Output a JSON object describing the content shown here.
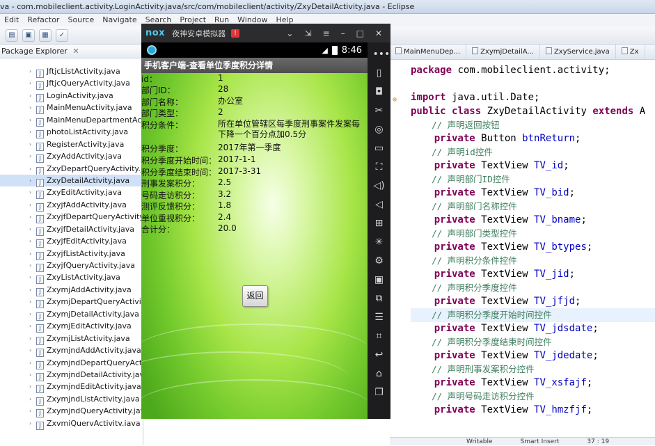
{
  "window": {
    "title": "va - com.mobileclient.activity.LoginActivity.java/src/com/mobileclient/activity/ZxyDetailActivity.java - Eclipse"
  },
  "menu": [
    "Edit",
    "Refactor",
    "Source",
    "Navigate",
    "Search",
    "Project",
    "Run",
    "Window",
    "Help"
  ],
  "package_explorer": {
    "title": "Package Explorer",
    "items": [
      "JftjcListActivity.java",
      "JftjcQueryActivity.java",
      "LoginActivity.java",
      "MainMenuActivity.java",
      "MainMenuDepartmentActi",
      "photoListActivity.java",
      "RegisterActivity.java",
      "ZxyAddActivity.java",
      "ZxyDepartQueryActivity.ja",
      "ZxyDetailActivity.java",
      "ZxyEditActivity.java",
      "ZxyjfAddActivity.java",
      "ZxyjfDepartQueryActivity.ja",
      "ZxyjfDetailActivity.java",
      "ZxyjfEditActivity.java",
      "ZxyjfListActivity.java",
      "ZxyjfQueryActivity.java",
      "ZxyListActivity.java",
      "ZxymjAddActivity.java",
      "ZxymjDepartQueryActivity.",
      "ZxymjDetailActivity.java",
      "ZxymjEditActivity.java",
      "ZxymjListActivity.java",
      "ZxymjndAddActivity.java",
      "ZxymjndDepartQueryActiv",
      "ZxymjndDetailActivity.java",
      "ZxymjndEditActivity.java",
      "ZxymjndListActivity.java",
      "ZxymjndQueryActivity.java",
      "ZxvmiQuervActivitv.iava"
    ],
    "selected_index": 9
  },
  "editor": {
    "tabs": [
      "MainMenuDep...",
      "ZxymjDetailA...",
      "ZxyService.java",
      "Zx"
    ],
    "lines": [
      {
        "t": "package com.mobileclient.activity;",
        "k": "pkg"
      },
      {
        "t": "",
        "k": "blank"
      },
      {
        "t": "import java.util.Date;",
        "k": "import"
      },
      {
        "t": "public class ZxyDetailActivity extends A",
        "k": "class"
      },
      {
        "t": "    // 声明返回按钮",
        "k": "comment"
      },
      {
        "t": "    private Button btnReturn;",
        "k": "field"
      },
      {
        "t": "    // 声明id控件",
        "k": "comment"
      },
      {
        "t": "    private TextView TV_id;",
        "k": "field"
      },
      {
        "t": "    // 声明部门ID控件",
        "k": "comment"
      },
      {
        "t": "    private TextView TV_bid;",
        "k": "field"
      },
      {
        "t": "    // 声明部门名称控件",
        "k": "comment"
      },
      {
        "t": "    private TextView TV_bname;",
        "k": "field"
      },
      {
        "t": "    // 声明部门类型控件",
        "k": "comment"
      },
      {
        "t": "    private TextView TV_btypes;",
        "k": "field"
      },
      {
        "t": "    // 声明积分条件控件",
        "k": "comment"
      },
      {
        "t": "    private TextView TV_jid;",
        "k": "field"
      },
      {
        "t": "    // 声明积分季度控件",
        "k": "comment"
      },
      {
        "t": "    private TextView TV_jfjd;",
        "k": "field"
      },
      {
        "t": "    // 声明积分季度开始时间控件",
        "k": "comment",
        "hl": true
      },
      {
        "t": "    private TextView TV_jdsdate;",
        "k": "field"
      },
      {
        "t": "    // 声明积分季度结束时间控件",
        "k": "comment"
      },
      {
        "t": "    private TextView TV_jdedate;",
        "k": "field"
      },
      {
        "t": "    // 声明刑事发案积分控件",
        "k": "comment"
      },
      {
        "t": "    private TextView TV_xsfajf;",
        "k": "field"
      },
      {
        "t": "    // 声明号码走访积分控件",
        "k": "comment"
      },
      {
        "t": "    private TextView TV_hmzfjf;",
        "k": "field"
      }
    ]
  },
  "status_bar": {
    "mode": "Writable",
    "insert": "Smart Insert",
    "position": "37 : 19"
  },
  "nox": {
    "logo": "nox",
    "title": "夜神安卓模拟器",
    "badge": "!",
    "clock": "8:46",
    "app_title": "手机客户端-查看单位季度积分详情",
    "back_button": "返回",
    "fields": [
      {
        "label": "id：",
        "value": "1"
      },
      {
        "label": "部门ID：",
        "value": "28"
      },
      {
        "label": "部门名称：",
        "value": "办公室"
      },
      {
        "label": "部门类型：",
        "value": "2"
      },
      {
        "label": "积分条件：",
        "value": "所在单位管辖区每季度刑事案件发案每下降一个百分点加0.5分"
      },
      {
        "label": "积分季度：",
        "value": "2017年第一季度"
      },
      {
        "label": "积分季度开始时间：",
        "value": "2017-1-1"
      },
      {
        "label": "积分季度结束时间：",
        "value": "2017-3-31"
      },
      {
        "label": "刑事发案积分：",
        "value": "2.5"
      },
      {
        "label": "号码走访积分：",
        "value": "3.2"
      },
      {
        "label": "测评反馈积分：",
        "value": "1.8"
      },
      {
        "label": "单位重视积分：",
        "value": "2.4"
      },
      {
        "label": "合计分：",
        "value": "20.0"
      }
    ]
  }
}
